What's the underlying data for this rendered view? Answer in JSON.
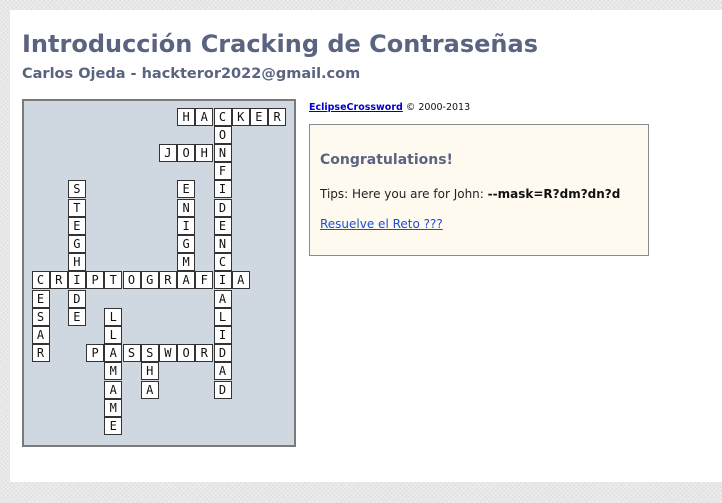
{
  "page": {
    "title": "Introducción Cracking de Contraseñas",
    "subtitle": "Carlos Ojeda - hackteror2022@gmail.com"
  },
  "credit": {
    "link_text": "EclipseCrossword",
    "copyright": "© 2000-2013"
  },
  "result": {
    "heading": "Congratulations!",
    "tips_prefix": "Tips: Here you are for John: ",
    "tips_value": "--mask=R?dm?dn?d",
    "reto_link": "Resuelve el Reto ???"
  },
  "crossword": {
    "words": [
      {
        "word": "HACKER",
        "dir": "across",
        "row": 0,
        "col": 8
      },
      {
        "word": "JOHN",
        "dir": "across",
        "row": 2,
        "col": 7
      },
      {
        "word": "CONFIDENCIALIDAD",
        "dir": "down",
        "row": 0,
        "col": 10
      },
      {
        "word": "STEGHIDE",
        "dir": "down",
        "row": 4,
        "col": 2
      },
      {
        "word": "ENIGMA",
        "dir": "down",
        "row": 4,
        "col": 8
      },
      {
        "word": "CRIPTOGRAFIA",
        "dir": "across",
        "row": 9,
        "col": 0
      },
      {
        "word": "CESAR",
        "dir": "down",
        "row": 9,
        "col": 0
      },
      {
        "word": "PASSWORD",
        "dir": "across",
        "row": 13,
        "col": 3
      },
      {
        "word": "LLAMAME",
        "dir": "down",
        "row": 11,
        "col": 4
      },
      {
        "word": "SHA",
        "dir": "down",
        "row": 13,
        "col": 6
      }
    ]
  }
}
